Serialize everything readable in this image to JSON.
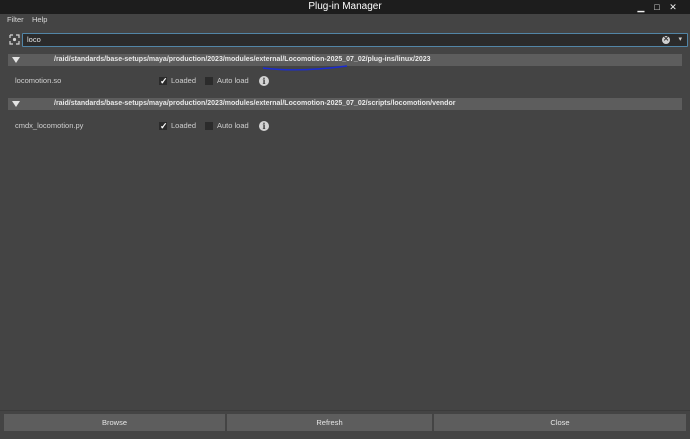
{
  "window": {
    "title": "Plug-in Manager",
    "minimize": "▁",
    "maximize": "□",
    "close": "✕"
  },
  "menu": {
    "items": [
      "Filter",
      "Help"
    ]
  },
  "search": {
    "value": "loco",
    "clear_glyph": "✕",
    "history_glyph": "▾"
  },
  "sections": [
    {
      "path": "/raid/standards/base-setups/maya/production/2023/modules/external/Locomotion-2025_07_02/plug-ins/linux/2023",
      "plugins": [
        {
          "name": "locomotion.so",
          "loaded": true,
          "auto_load": false,
          "loaded_label": "Loaded",
          "auto_load_label": "Auto load",
          "info": "i"
        }
      ]
    },
    {
      "path": "/raid/standards/base-setups/maya/production/2023/modules/external/Locomotion-2025_07_02/scripts/locomotion/vendor",
      "plugins": [
        {
          "name": "cmdx_locomotion.py",
          "loaded": true,
          "auto_load": false,
          "loaded_label": "Loaded",
          "auto_load_label": "Auto load",
          "info": "i"
        }
      ]
    }
  ],
  "buttons": {
    "browse": "Browse",
    "refresh": "Refresh",
    "close": "Close"
  },
  "colors": {
    "accent_focus": "#5285a6",
    "annotation": "#1a2bd1",
    "panel": "#444444",
    "header": "#5d5d5d",
    "titlebar": "#1d1d1d"
  },
  "icons": {
    "filter": "filter-icon",
    "expand": "triangle-down-icon",
    "info": "info-icon"
  }
}
